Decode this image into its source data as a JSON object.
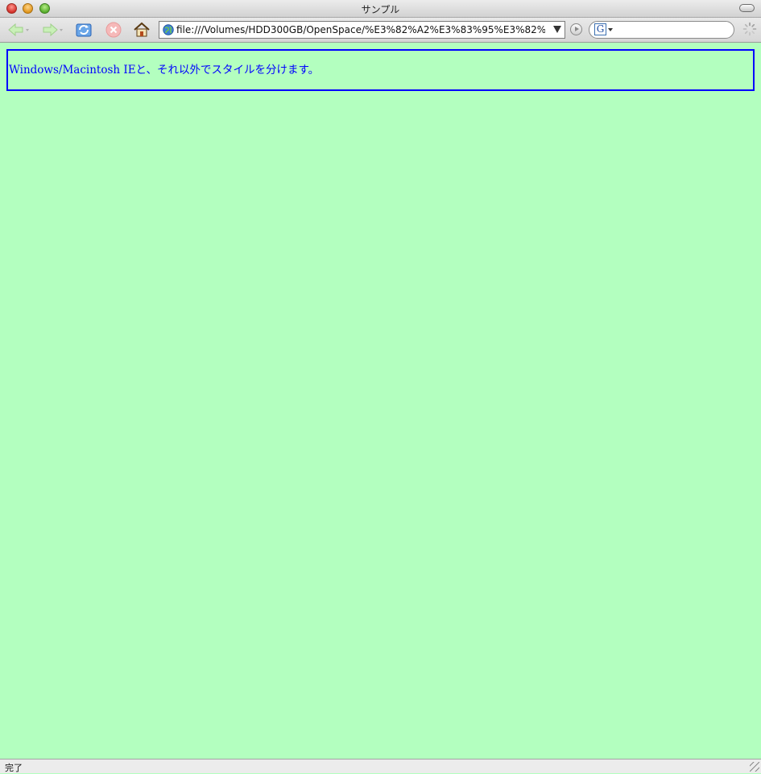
{
  "window": {
    "title": "サンプル"
  },
  "toolbar": {
    "back_icon": "back-arrow-icon",
    "forward_icon": "forward-arrow-icon",
    "reload_icon": "reload-icon",
    "stop_icon": "stop-icon",
    "home_icon": "home-icon",
    "address": "file:///Volumes/HDD300GB/OpenSpace/%E3%82%A2%E3%83%95%E3%82%9A%",
    "search_engine": "G",
    "search_value": ""
  },
  "content": {
    "message": "Windows/Macintosh IEと、それ以外でスタイルを分けます。",
    "background_color": "#b3ffbf",
    "text_color": "#0000ff",
    "border_color": "#0000ff"
  },
  "status": {
    "text": "完了"
  }
}
